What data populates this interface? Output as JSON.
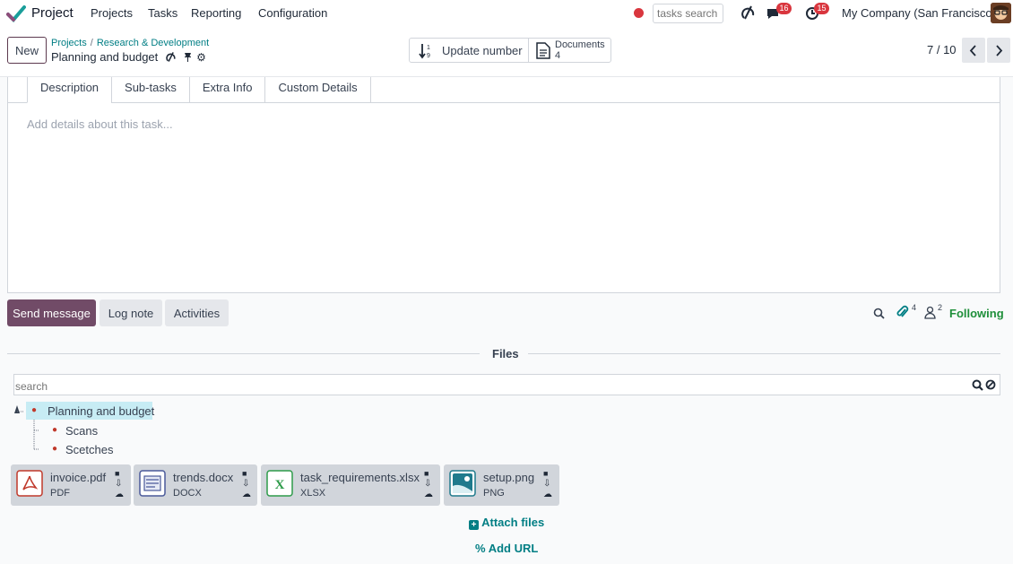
{
  "topnav": {
    "brand": "Project",
    "menu": [
      "Projects",
      "Tasks",
      "Reporting",
      "Configuration"
    ],
    "search_placeholder": "tasks search",
    "messages_badge": "16",
    "activities_badge": "15",
    "company": "My Company (San Francisco)"
  },
  "control": {
    "new_label": "New",
    "breadcrumb": [
      "Projects",
      "Research & Development"
    ],
    "record_name": "Planning and budget",
    "update_number_label": "Update number",
    "documents_label": "Documents",
    "documents_count": "4",
    "pager": "7 / 10"
  },
  "tabs": [
    "Description",
    "Sub-tasks",
    "Extra Info",
    "Custom Details"
  ],
  "description_placeholder": "Add details about this task...",
  "chatter": {
    "send_message": "Send message",
    "log_note": "Log note",
    "activities": "Activities",
    "attachments_count": "4",
    "followers_count": "2",
    "following": "Following"
  },
  "files": {
    "title": "Files",
    "search_placeholder": "search",
    "tree": {
      "root": "Planning and budget",
      "children": [
        "Scans",
        "Scetches"
      ]
    },
    "items": [
      {
        "name": "invoice.pdf",
        "type": "PDF"
      },
      {
        "name": "trends.docx",
        "type": "DOCX"
      },
      {
        "name": "task_requirements.xlsx",
        "type": "XLSX"
      },
      {
        "name": "setup.png",
        "type": "PNG"
      }
    ],
    "attach_files": "Attach files",
    "add_url": "Add URL"
  },
  "colors": {
    "primary": "#714b67",
    "teal": "#017e84",
    "badge_red": "#d9363e",
    "following_green": "#1f8f3a"
  }
}
